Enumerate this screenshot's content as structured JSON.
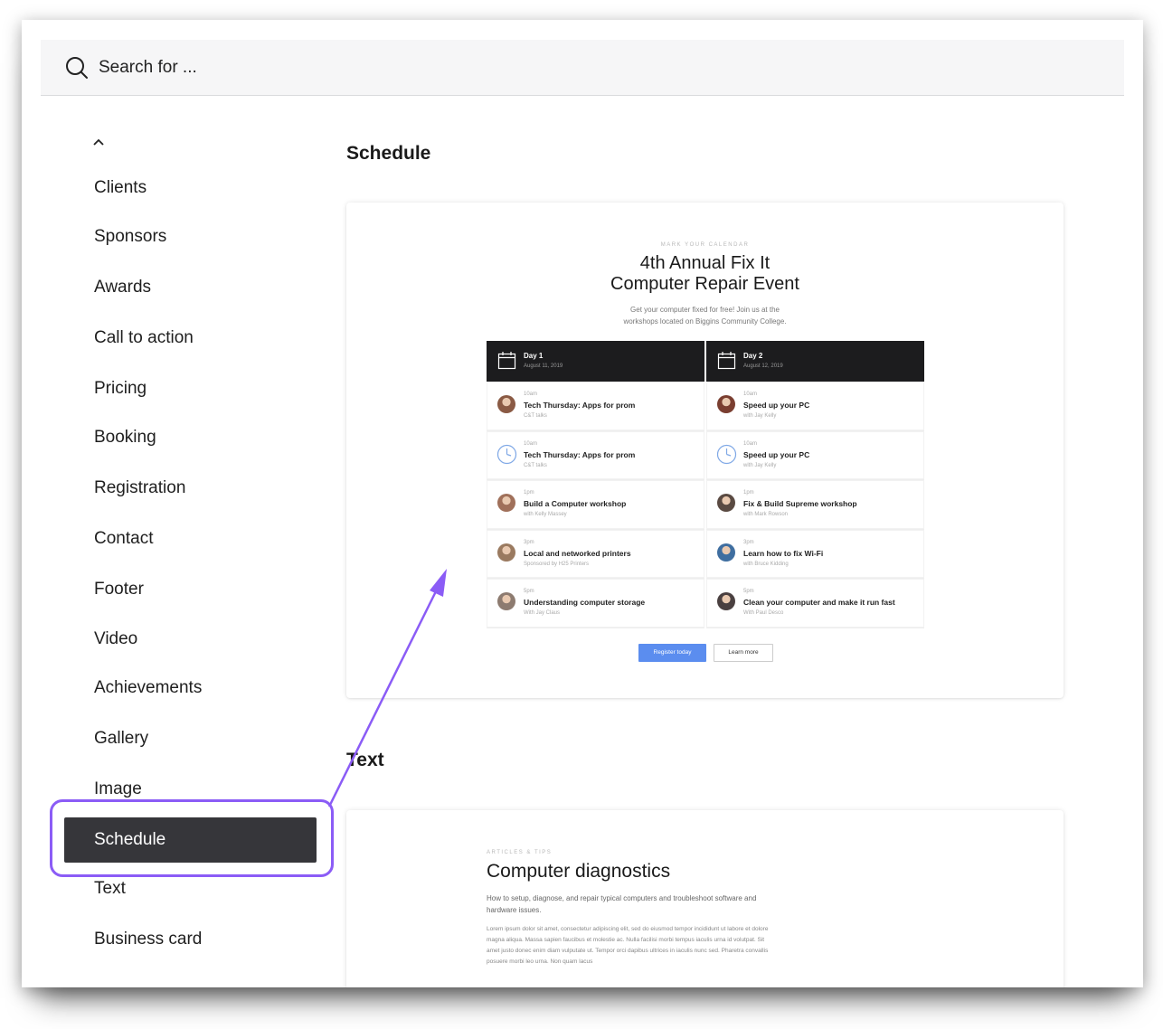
{
  "search": {
    "placeholder": "Search for ..."
  },
  "sidebar": {
    "items": [
      "Clients",
      "Sponsors",
      "Awards",
      "Call to action",
      "Pricing",
      "Booking",
      "Registration",
      "Contact",
      "Footer",
      "Video",
      "Achievements",
      "Gallery",
      "Image",
      "Schedule",
      "Text",
      "Business card"
    ],
    "active": "Schedule"
  },
  "sections": {
    "schedule": {
      "title": "Schedule",
      "preview": {
        "eyebrow": "MARK YOUR CALENDAR",
        "title_line1": "4th Annual Fix It",
        "title_line2": "Computer Repair Event",
        "sub_line1": "Get your computer fixed for free! Join us at the",
        "sub_line2": "workshops located on Biggins Community College.",
        "days": [
          {
            "label": "Day 1",
            "date": "August 11, 2019",
            "sessions": [
              {
                "time": "10am",
                "title": "Tech Thursday: Apps for prom",
                "sub": "C&T talks",
                "icon": "avatar",
                "color": "#8a5a44"
              },
              {
                "time": "10am",
                "title": "Tech Thursday: Apps for prom",
                "sub": "C&T talks",
                "icon": "clock",
                "color": "#7fa8e6"
              },
              {
                "time": "1pm",
                "title": "Build a Computer workshop",
                "sub": "with Kelly Massey",
                "icon": "avatar",
                "color": "#a0705a"
              },
              {
                "time": "3pm",
                "title": "Local and networked printers",
                "sub": "Sponsored by H25 Printers",
                "icon": "avatar",
                "color": "#9a7a60"
              },
              {
                "time": "5pm",
                "title": "Understanding computer storage",
                "sub": "With Jay Claus",
                "icon": "avatar",
                "color": "#8d7b70"
              }
            ]
          },
          {
            "label": "Day 2",
            "date": "August 12, 2019",
            "sessions": [
              {
                "time": "10am",
                "title": "Speed up your PC",
                "sub": "with Jay Kelly",
                "icon": "avatar",
                "color": "#7a3e30"
              },
              {
                "time": "10am",
                "title": "Speed up your PC",
                "sub": "with Jay Kelly",
                "icon": "clock",
                "color": "#7fa8e6"
              },
              {
                "time": "1pm",
                "title": "Fix & Build Supreme workshop",
                "sub": "with Mark Rowson",
                "icon": "avatar",
                "color": "#5a4a42"
              },
              {
                "time": "3pm",
                "title": "Learn how to fix Wi-Fi",
                "sub": "with Bruce Kidding",
                "icon": "avatar",
                "color": "#3f6ea0"
              },
              {
                "time": "5pm",
                "title": "Clean your computer and make it run fast",
                "sub": "With Paul Desco",
                "icon": "avatar",
                "color": "#4a4040"
              }
            ]
          }
        ],
        "primary_button": "Register today",
        "secondary_button": "Learn more"
      }
    },
    "text": {
      "title": "Text",
      "preview": {
        "eyebrow": "ARTICLES & TIPS",
        "title": "Computer diagnostics",
        "lead": "How to setup, diagnose, and repair typical computers and troubleshoot software and hardware issues.",
        "body": "Lorem ipsum dolor sit amet, consectetur adipiscing elit, sed do eiusmod tempor incididunt ut labore et dolore magna aliqua. Massa sapien faucibus et molestie ac. Nulla facilisi morbi tempus iaculis urna id volutpat. Sit amet justo donec enim diam vulputate ut. Tempor orci dapibus ultrices in iaculis nunc sed. Pharetra convallis posuere morbi leo urna. Non quam lacus"
      }
    }
  },
  "colors": {
    "active_bg": "#36363a",
    "highlight": "#8b5cf6",
    "primary": "#5b8def"
  }
}
